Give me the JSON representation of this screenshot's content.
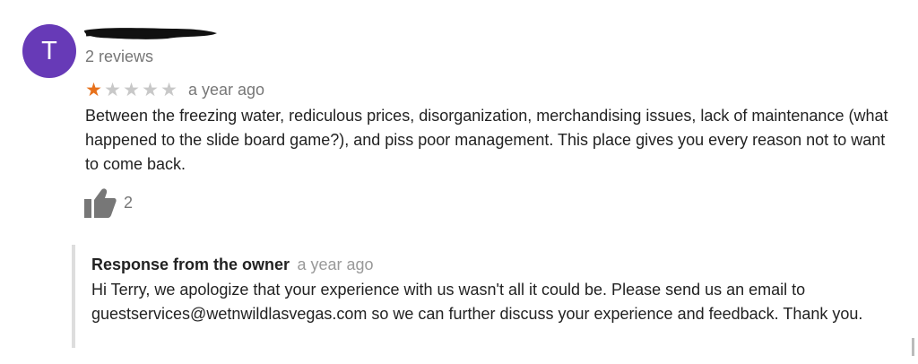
{
  "review": {
    "avatar_letter": "T",
    "review_count": "2 reviews",
    "rating": 1,
    "max_rating": 5,
    "time": "a year ago",
    "text": "Between the freezing water, rediculous prices, disorganization, merchandising issues, lack of maintenance (what happened to the slide board game?), and piss poor management. This place gives you every reason not to want to come back.",
    "likes": "2"
  },
  "owner_response": {
    "title": "Response from the owner",
    "time": "a year ago",
    "text": "Hi Terry, we apologize that your experience with us wasn't all it could be. Please send us an email to guestservices@wetnwildlasvegas.com so we can further discuss your experience and feedback. Thank you."
  },
  "colors": {
    "avatar": "#673ab7",
    "star_filled": "#e7711b",
    "star_empty": "#c8c8c8",
    "secondary_text": "#777777"
  }
}
